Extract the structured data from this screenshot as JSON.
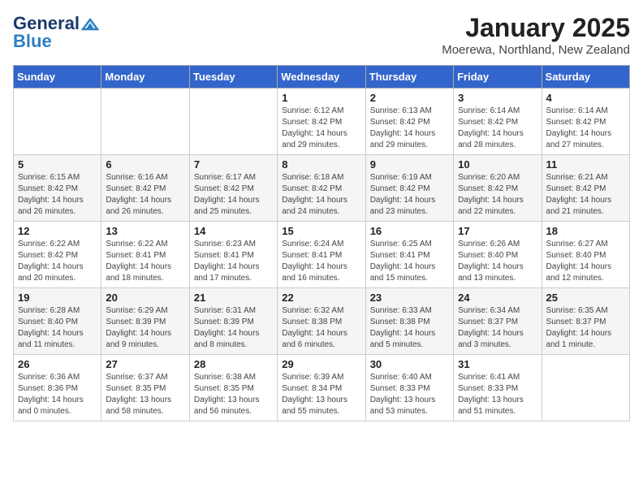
{
  "header": {
    "logo_general": "General",
    "logo_blue": "Blue",
    "title": "January 2025",
    "subtitle": "Moerewa, Northland, New Zealand"
  },
  "days_of_week": [
    "Sunday",
    "Monday",
    "Tuesday",
    "Wednesday",
    "Thursday",
    "Friday",
    "Saturday"
  ],
  "weeks": [
    [
      {
        "day": "",
        "info": ""
      },
      {
        "day": "",
        "info": ""
      },
      {
        "day": "",
        "info": ""
      },
      {
        "day": "1",
        "info": "Sunrise: 6:12 AM\nSunset: 8:42 PM\nDaylight: 14 hours and 29 minutes."
      },
      {
        "day": "2",
        "info": "Sunrise: 6:13 AM\nSunset: 8:42 PM\nDaylight: 14 hours and 29 minutes."
      },
      {
        "day": "3",
        "info": "Sunrise: 6:14 AM\nSunset: 8:42 PM\nDaylight: 14 hours and 28 minutes."
      },
      {
        "day": "4",
        "info": "Sunrise: 6:14 AM\nSunset: 8:42 PM\nDaylight: 14 hours and 27 minutes."
      }
    ],
    [
      {
        "day": "5",
        "info": "Sunrise: 6:15 AM\nSunset: 8:42 PM\nDaylight: 14 hours and 26 minutes."
      },
      {
        "day": "6",
        "info": "Sunrise: 6:16 AM\nSunset: 8:42 PM\nDaylight: 14 hours and 26 minutes."
      },
      {
        "day": "7",
        "info": "Sunrise: 6:17 AM\nSunset: 8:42 PM\nDaylight: 14 hours and 25 minutes."
      },
      {
        "day": "8",
        "info": "Sunrise: 6:18 AM\nSunset: 8:42 PM\nDaylight: 14 hours and 24 minutes."
      },
      {
        "day": "9",
        "info": "Sunrise: 6:19 AM\nSunset: 8:42 PM\nDaylight: 14 hours and 23 minutes."
      },
      {
        "day": "10",
        "info": "Sunrise: 6:20 AM\nSunset: 8:42 PM\nDaylight: 14 hours and 22 minutes."
      },
      {
        "day": "11",
        "info": "Sunrise: 6:21 AM\nSunset: 8:42 PM\nDaylight: 14 hours and 21 minutes."
      }
    ],
    [
      {
        "day": "12",
        "info": "Sunrise: 6:22 AM\nSunset: 8:42 PM\nDaylight: 14 hours and 20 minutes."
      },
      {
        "day": "13",
        "info": "Sunrise: 6:22 AM\nSunset: 8:41 PM\nDaylight: 14 hours and 18 minutes."
      },
      {
        "day": "14",
        "info": "Sunrise: 6:23 AM\nSunset: 8:41 PM\nDaylight: 14 hours and 17 minutes."
      },
      {
        "day": "15",
        "info": "Sunrise: 6:24 AM\nSunset: 8:41 PM\nDaylight: 14 hours and 16 minutes."
      },
      {
        "day": "16",
        "info": "Sunrise: 6:25 AM\nSunset: 8:41 PM\nDaylight: 14 hours and 15 minutes."
      },
      {
        "day": "17",
        "info": "Sunrise: 6:26 AM\nSunset: 8:40 PM\nDaylight: 14 hours and 13 minutes."
      },
      {
        "day": "18",
        "info": "Sunrise: 6:27 AM\nSunset: 8:40 PM\nDaylight: 14 hours and 12 minutes."
      }
    ],
    [
      {
        "day": "19",
        "info": "Sunrise: 6:28 AM\nSunset: 8:40 PM\nDaylight: 14 hours and 11 minutes."
      },
      {
        "day": "20",
        "info": "Sunrise: 6:29 AM\nSunset: 8:39 PM\nDaylight: 14 hours and 9 minutes."
      },
      {
        "day": "21",
        "info": "Sunrise: 6:31 AM\nSunset: 8:39 PM\nDaylight: 14 hours and 8 minutes."
      },
      {
        "day": "22",
        "info": "Sunrise: 6:32 AM\nSunset: 8:38 PM\nDaylight: 14 hours and 6 minutes."
      },
      {
        "day": "23",
        "info": "Sunrise: 6:33 AM\nSunset: 8:38 PM\nDaylight: 14 hours and 5 minutes."
      },
      {
        "day": "24",
        "info": "Sunrise: 6:34 AM\nSunset: 8:37 PM\nDaylight: 14 hours and 3 minutes."
      },
      {
        "day": "25",
        "info": "Sunrise: 6:35 AM\nSunset: 8:37 PM\nDaylight: 14 hours and 1 minute."
      }
    ],
    [
      {
        "day": "26",
        "info": "Sunrise: 6:36 AM\nSunset: 8:36 PM\nDaylight: 14 hours and 0 minutes."
      },
      {
        "day": "27",
        "info": "Sunrise: 6:37 AM\nSunset: 8:35 PM\nDaylight: 13 hours and 58 minutes."
      },
      {
        "day": "28",
        "info": "Sunrise: 6:38 AM\nSunset: 8:35 PM\nDaylight: 13 hours and 56 minutes."
      },
      {
        "day": "29",
        "info": "Sunrise: 6:39 AM\nSunset: 8:34 PM\nDaylight: 13 hours and 55 minutes."
      },
      {
        "day": "30",
        "info": "Sunrise: 6:40 AM\nSunset: 8:33 PM\nDaylight: 13 hours and 53 minutes."
      },
      {
        "day": "31",
        "info": "Sunrise: 6:41 AM\nSunset: 8:33 PM\nDaylight: 13 hours and 51 minutes."
      },
      {
        "day": "",
        "info": ""
      }
    ]
  ]
}
